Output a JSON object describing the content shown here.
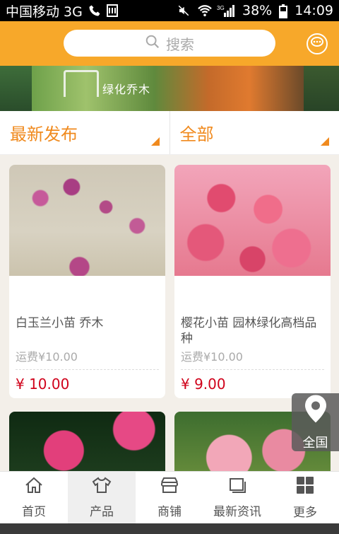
{
  "statusbar": {
    "carrier": "中国移动 3G",
    "network": "3G",
    "battery": "38%",
    "time": "14:09"
  },
  "header": {
    "search_placeholder": "搜索"
  },
  "banner": {
    "title": "绿化乔木"
  },
  "filters": [
    {
      "label": "最新发布"
    },
    {
      "label": "全部"
    }
  ],
  "products": [
    {
      "name": "白玉兰小苗 乔木",
      "shipping": "运费¥10.00",
      "price": "¥ 10.00"
    },
    {
      "name": "樱花小苗 园林绿化高档品种",
      "shipping": "运费¥10.00",
      "price": "¥ 9.00"
    }
  ],
  "location_button": {
    "label": "全国"
  },
  "tabbar": [
    {
      "label": "首页",
      "icon": "home-icon"
    },
    {
      "label": "产品",
      "icon": "shirt-icon"
    },
    {
      "label": "商铺",
      "icon": "shop-icon"
    },
    {
      "label": "最新资讯",
      "icon": "news-icon"
    },
    {
      "label": "更多",
      "icon": "grid-icon"
    }
  ],
  "colors": {
    "accent": "#f7a82a",
    "filter_text": "#f08a1e",
    "price": "#d0021b"
  }
}
